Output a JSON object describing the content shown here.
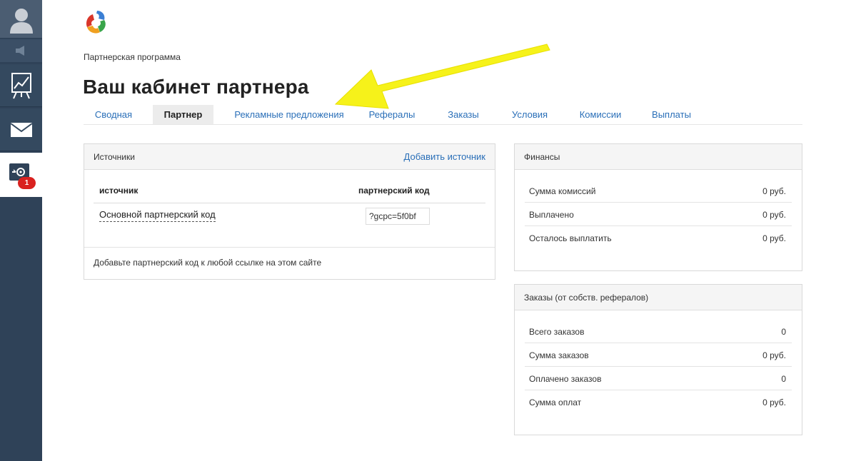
{
  "sidebar": {
    "badge_count": "1",
    "items": [
      {
        "name": "avatar-icon"
      },
      {
        "name": "speaker-icon"
      },
      {
        "name": "chart-icon"
      },
      {
        "name": "mail-icon"
      },
      {
        "name": "partner-settings-icon"
      }
    ],
    "active_color": "#ffffff",
    "badge_color": "#d9211f"
  },
  "header": {
    "breadcrumb": "Партнерская программа",
    "title": "Ваш кабинет партнера"
  },
  "tabs": [
    {
      "label": "Сводная",
      "active": false
    },
    {
      "label": "Партнер",
      "active": true
    },
    {
      "label": "Рекламные предложения",
      "active": false
    },
    {
      "label": "Рефералы",
      "active": false
    },
    {
      "label": "Заказы",
      "active": false
    },
    {
      "label": "Условия",
      "active": false
    },
    {
      "label": "Комиссии",
      "active": false
    },
    {
      "label": "Выплаты",
      "active": false
    }
  ],
  "sources": {
    "title": "Источники",
    "add_link": "Добавить источник",
    "col_source": "источник",
    "col_code": "партнерский код",
    "rows": [
      {
        "name": "Основной партнерский код",
        "code": "?gcpc=5f0bf"
      }
    ],
    "hint": "Добавьте партнерский код к любой ссылке на этом сайте"
  },
  "finance": {
    "title": "Финансы",
    "rows": [
      {
        "label": "Сумма комиссий",
        "value": "0 руб."
      },
      {
        "label": "Выплачено",
        "value": "0 руб."
      },
      {
        "label": "Осталось выплатить",
        "value": "0 руб."
      }
    ]
  },
  "orders": {
    "title": "Заказы (от собств. рефералов)",
    "rows": [
      {
        "label": "Всего заказов",
        "value": "0"
      },
      {
        "label": "Сумма заказов",
        "value": "0 руб."
      },
      {
        "label": "Оплачено заказов",
        "value": "0"
      },
      {
        "label": "Сумма оплат",
        "value": "0 руб."
      }
    ]
  },
  "colors": {
    "link": "#2a6fb8",
    "sidebar": "#2f4258",
    "arrow": "#f6f21a"
  }
}
